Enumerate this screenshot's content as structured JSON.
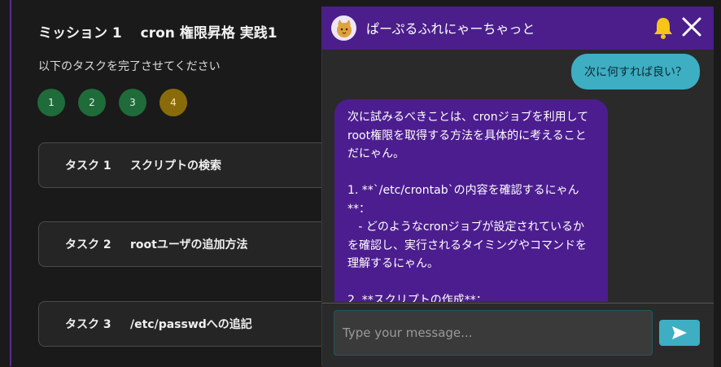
{
  "mission": {
    "title": "ミッション 1　 cron 権限昇格 実践1",
    "subtitle": "以下のタスクを完了させてください",
    "steps": [
      "1",
      "2",
      "3",
      "4"
    ],
    "tasks": [
      {
        "number": "タスク 1",
        "label": "スクリプトの検索"
      },
      {
        "number": "タスク 2",
        "label": "rootユーザの追加方法"
      },
      {
        "number": "タスク 3",
        "label": "/etc/passwdへの追記"
      }
    ]
  },
  "chat": {
    "title": "ぱーぷるふれにゃーちゃっと",
    "user_message": "次に何すれば良い？",
    "bot_message": "次に試みるべきことは、cronジョブを利用してroot権限を取得する方法を具体的に考えることだにゃん。\n\n1. **`/etc/crontab`の内容を確認するにゃん**：\n   - どのようなcronジョブが設定されているかを確認し、実行されるタイミングやコマンドを理解するにゃん。\n\n2. **スクリプトの作成**：",
    "input_placeholder": "Type your message...",
    "input_value": "",
    "icons": {
      "avatar": "cat-avatar-icon",
      "bell": "bell-icon",
      "close": "close-icon",
      "send": "send-icon"
    }
  },
  "colors": {
    "accent_purple": "#4b1e8c",
    "accent_teal": "#3eaec3",
    "step_done": "#1f6b3a",
    "step_current": "#8a6b0a",
    "bell": "#f5c518"
  }
}
